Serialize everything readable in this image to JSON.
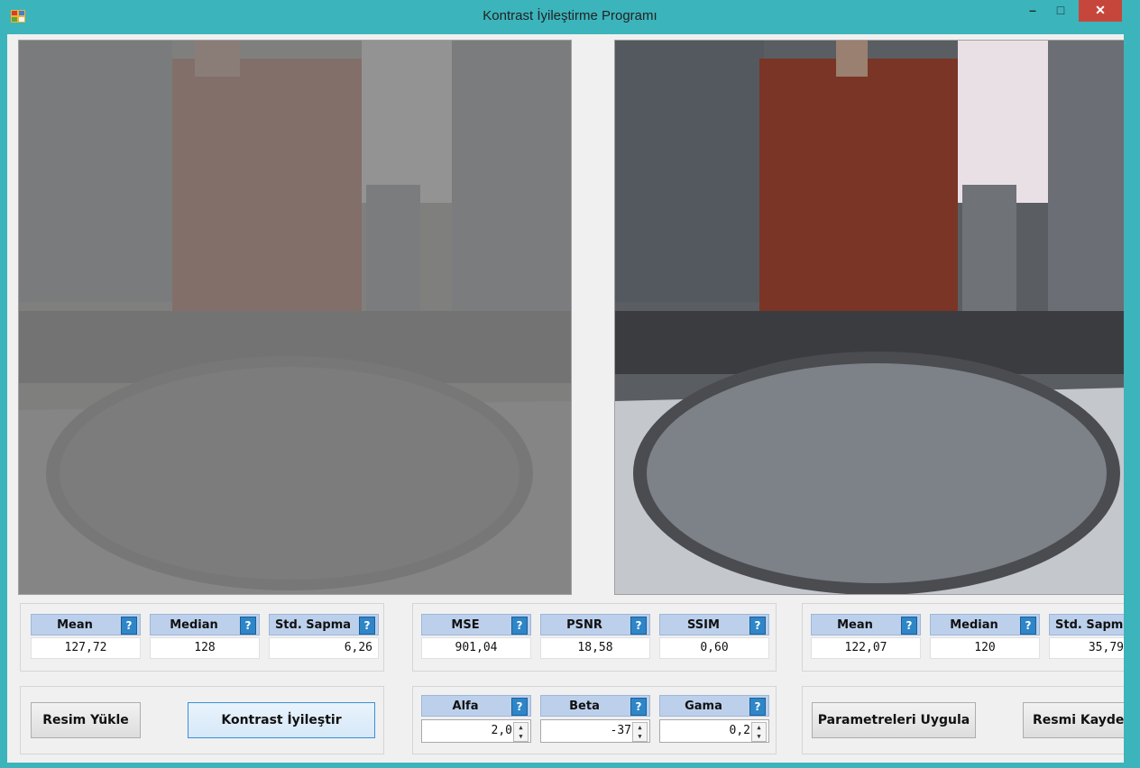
{
  "window": {
    "title": "Kontrast İyileştirme Programı",
    "minimize": "–",
    "maximize": "□",
    "close": "✕"
  },
  "left_stats": {
    "mean_label": "Mean",
    "median_label": "Median",
    "std_label": "Std. Sapma",
    "mean": "127,72",
    "median": "128",
    "std": "6,26"
  },
  "metrics": {
    "mse_label": "MSE",
    "psnr_label": "PSNR",
    "ssim_label": "SSIM",
    "mse": "901,04",
    "psnr": "18,58",
    "ssim": "0,60"
  },
  "right_stats": {
    "mean_label": "Mean",
    "median_label": "Median",
    "std_label": "Std. Sapm",
    "mean": "122,07",
    "median": "120",
    "std": "35,79"
  },
  "params": {
    "alfa_label": "Alfa",
    "beta_label": "Beta",
    "gama_label": "Gama",
    "alfa": "2,0",
    "beta": "-37",
    "gama": "0,2"
  },
  "buttons": {
    "load": "Resim Yükle",
    "enhance": "Kontrast İyileştir",
    "apply": "Parametreleri Uygula",
    "save": "Resmi Kayde"
  },
  "help_glyph": "?",
  "spin_up": "▲",
  "spin_down": "▼",
  "colors": {
    "titlebar": "#3cb4bc",
    "label_bg": "#bcd0ec",
    "help_button": "#2e86c8",
    "close_button": "#c7463c"
  }
}
